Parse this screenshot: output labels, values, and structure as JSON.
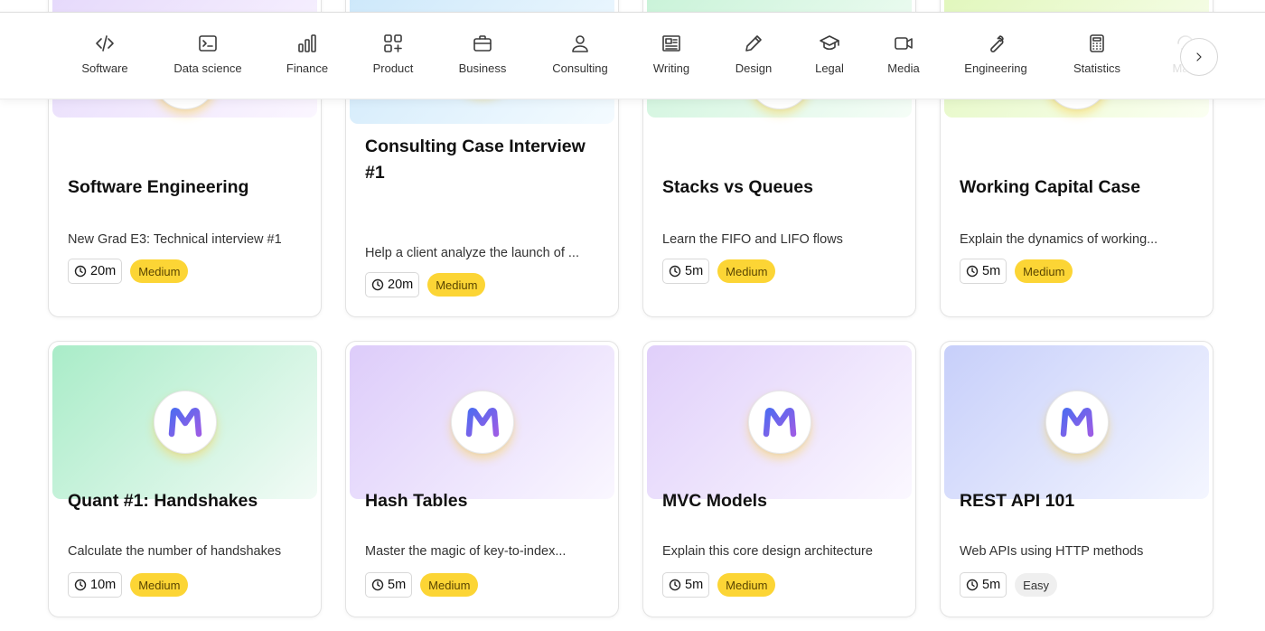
{
  "categories": [
    {
      "label": "Software",
      "icon": "code-icon"
    },
    {
      "label": "Data science",
      "icon": "terminal-icon"
    },
    {
      "label": "Finance",
      "icon": "bar-chart-icon"
    },
    {
      "label": "Product",
      "icon": "grid-plus-icon"
    },
    {
      "label": "Business",
      "icon": "briefcase-icon"
    },
    {
      "label": "Consulting",
      "icon": "user-icon"
    },
    {
      "label": "Writing",
      "icon": "newspaper-icon"
    },
    {
      "label": "Design",
      "icon": "pencil-icon"
    },
    {
      "label": "Legal",
      "icon": "graduation-cap-icon"
    },
    {
      "label": "Media",
      "icon": "video-icon"
    },
    {
      "label": "Engineering",
      "icon": "wrench-icon"
    },
    {
      "label": "Statistics",
      "icon": "calculator-icon"
    },
    {
      "label": "Mark",
      "icon": "partial-icon"
    }
  ],
  "cards": [
    {
      "title": "Software Engineering",
      "description": "New Grad E3: Technical interview #1",
      "duration": "20m",
      "difficulty": "Medium",
      "gradient": [
        "#e4d7fb",
        "#fbf6ff"
      ]
    },
    {
      "title": "Consulting Case Interview #1",
      "description": "Help a client analyze the launch of ...",
      "duration": "20m",
      "difficulty": "Medium",
      "gradient": [
        "#c9e6fa",
        "#f4fbff"
      ]
    },
    {
      "title": "Stacks vs Queues",
      "description": "Learn the FIFO and LIFO flows",
      "duration": "5m",
      "difficulty": "Medium",
      "gradient": [
        "#c6f2d6",
        "#f5fdf7"
      ]
    },
    {
      "title": "Working Capital Case",
      "description": "Explain the dynamics of working...",
      "duration": "5m",
      "difficulty": "Medium",
      "gradient": [
        "#dff6b8",
        "#fbfff2"
      ]
    },
    {
      "title": "Quant #1: Handshakes",
      "description": "Calculate the number of handshakes",
      "duration": "10m",
      "difficulty": "Medium",
      "gradient": [
        "#a9ecc8",
        "#f2fbf6"
      ]
    },
    {
      "title": "Hash Tables",
      "description": "Master the magic of key-to-index...",
      "duration": "5m",
      "difficulty": "Medium",
      "gradient": [
        "#ddccfa",
        "#faf7ff"
      ]
    },
    {
      "title": "MVC Models",
      "description": "Explain this core design architecture",
      "duration": "5m",
      "difficulty": "Medium",
      "gradient": [
        "#e0cffa",
        "#fbf8ff"
      ]
    },
    {
      "title": "REST API 101",
      "description": "Web APIs using HTTP methods",
      "duration": "5m",
      "difficulty": "Easy",
      "gradient": [
        "#c7cffa",
        "#f4f6ff"
      ]
    }
  ],
  "colors": {
    "medium_badge": "#fcd535",
    "easy_badge": "#efefef",
    "logo_gradient": [
      "#4f6bf0",
      "#9b5de5"
    ]
  }
}
